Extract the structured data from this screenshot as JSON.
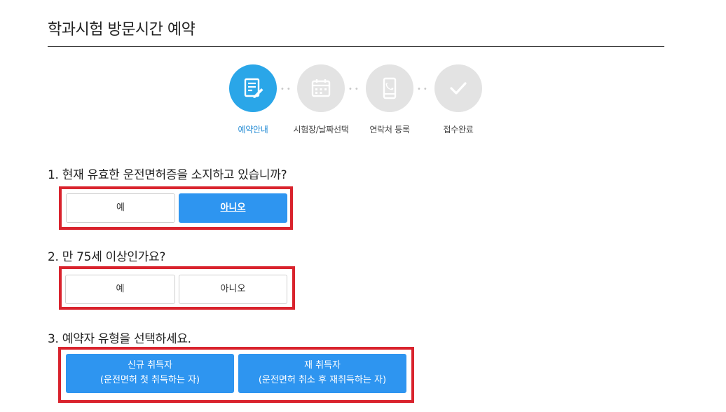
{
  "page": {
    "title": "학과시험 방문시간 예약"
  },
  "steps": [
    {
      "label": "예약안내",
      "icon": "document-edit-icon",
      "active": true
    },
    {
      "label": "시험장/날짜선택",
      "icon": "calendar-icon",
      "active": false
    },
    {
      "label": "연락처 등록",
      "icon": "phone-icon",
      "active": false
    },
    {
      "label": "접수완료",
      "icon": "check-icon",
      "active": false
    }
  ],
  "questions": [
    {
      "text": "1. 현재 유효한 운전면허증을 소지하고 있습니까?",
      "options": [
        "예",
        "아니오"
      ],
      "selected": "아니오"
    },
    {
      "text": "2. 만 75세 이상인가요?",
      "options": [
        "예",
        "아니오"
      ],
      "selected": ""
    },
    {
      "text": "3. 예약자 유형을 선택하세요.",
      "options": [
        {
          "title": "신규 취득자",
          "desc": "(운전면허 첫 취득하는 자)"
        },
        {
          "title": "재 취득자",
          "desc": "(운전면허 취소 후 재취득하는 자)"
        }
      ]
    }
  ],
  "colors": {
    "accent": "#2e95f0",
    "step_active": "#2aa6e8",
    "highlight_border": "#d9232d"
  }
}
